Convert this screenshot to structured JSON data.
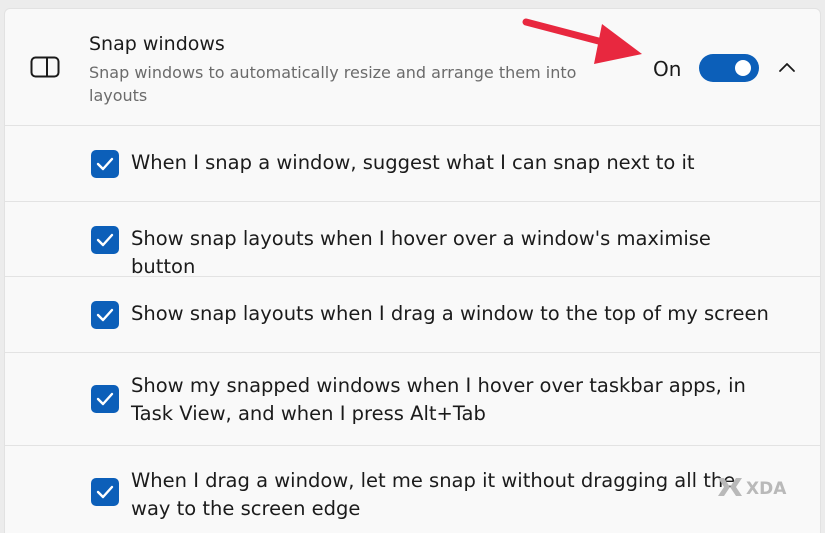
{
  "setting": {
    "icon": "snap-window-icon",
    "title": "Snap windows",
    "description": "Snap windows to automatically resize and arrange them into layouts",
    "state_label": "On",
    "toggle_on": true,
    "expanded": true
  },
  "options": [
    {
      "label": "When I snap a window, suggest what I can snap next to it",
      "checked": true
    },
    {
      "label": "Show snap layouts when I hover over a window's maximise button",
      "checked": true
    },
    {
      "label": "Show snap layouts when I drag a window to the top of my screen",
      "checked": true
    },
    {
      "label": "Show my snapped windows when I hover over taskbar apps, in Task View, and when I press Alt+Tab",
      "checked": true
    },
    {
      "label": "When I drag a window, let me snap it without dragging all the way to the screen edge",
      "checked": true
    }
  ],
  "colors": {
    "accent": "#0c5fb9",
    "annotation_arrow": "#e8283f"
  },
  "watermark": "XDA"
}
